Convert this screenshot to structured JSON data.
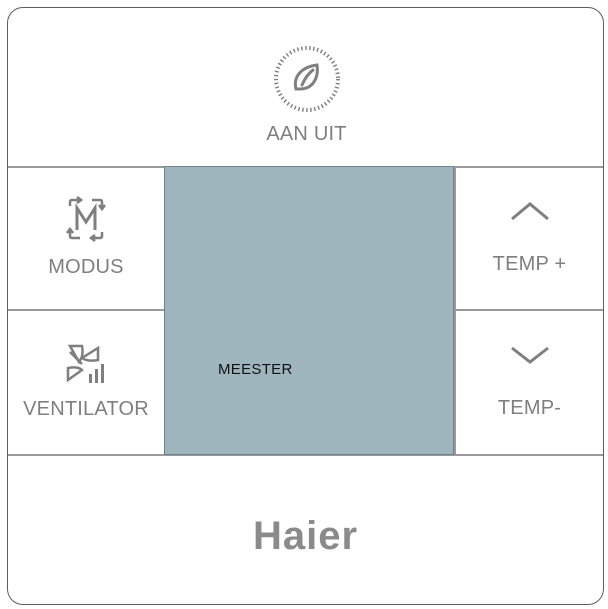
{
  "power": {
    "label": "AAN UIT",
    "icon": "eco-leaf-power-icon"
  },
  "mode": {
    "label": "MODUS",
    "icon": "mode-m-cycle-icon"
  },
  "fan": {
    "label": "VENTILATOR",
    "icon": "fan-speed-icon"
  },
  "temp_up": {
    "label": "TEMP +",
    "icon": "chevron-up-icon"
  },
  "temp_down": {
    "label": "TEMP-",
    "icon": "chevron-down-icon"
  },
  "display": {
    "text": "MEESTER",
    "background": "#9fb5bd"
  },
  "brand": {
    "name": "Haier"
  }
}
